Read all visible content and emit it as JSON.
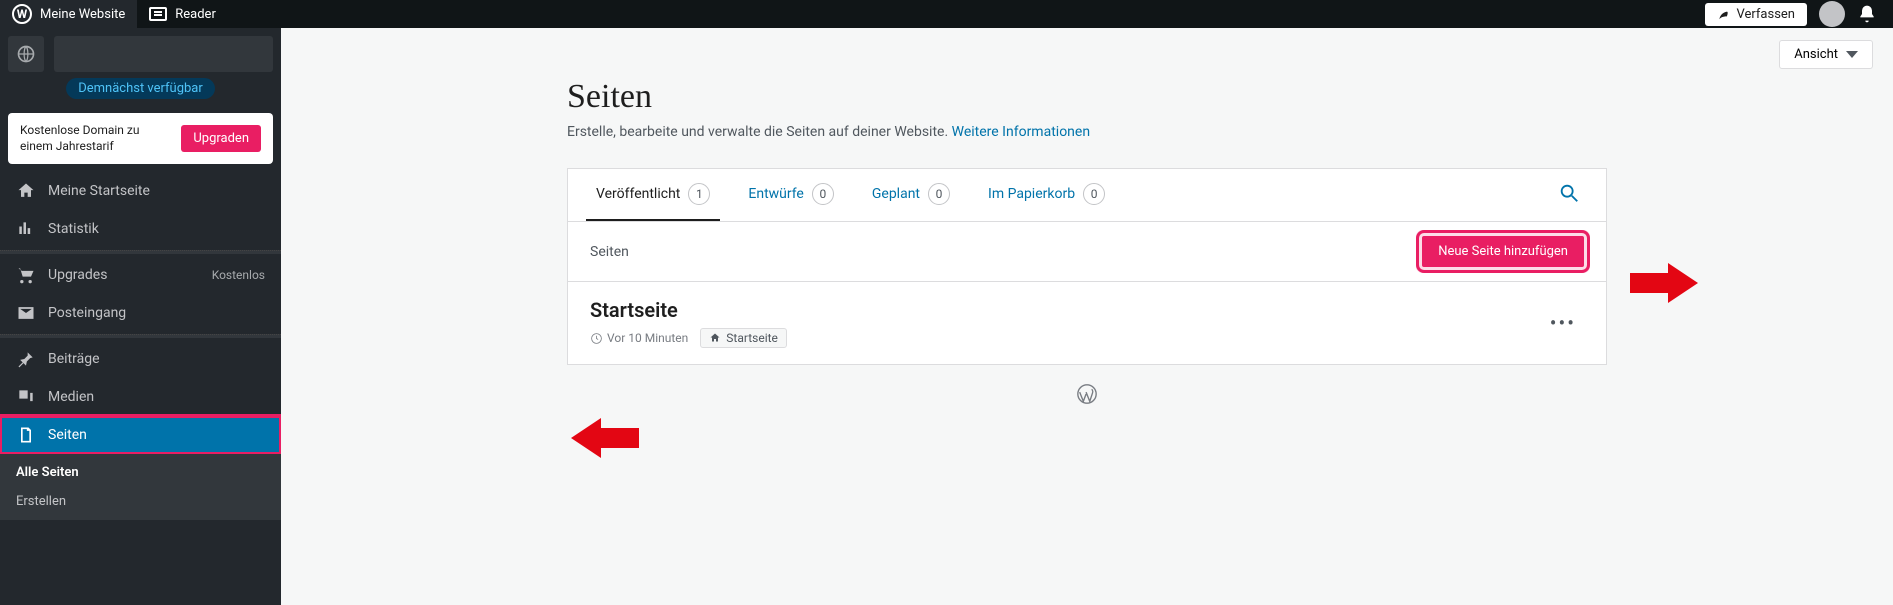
{
  "topbar": {
    "my_site": "Meine Website",
    "reader": "Reader",
    "compose": "Verfassen"
  },
  "sidebar": {
    "coming_soon": "Demnächst verfügbar",
    "domain_promo": "Kostenlose Domain zu einem Jahrestarif",
    "upgrade_btn": "Upgraden",
    "items": {
      "home": "Meine Startseite",
      "stats": "Statistik",
      "upgrades": "Upgrades",
      "upgrades_meta": "Kostenlos",
      "inbox": "Posteingang",
      "posts": "Beiträge",
      "media": "Medien",
      "pages": "Seiten"
    },
    "submenu": {
      "all_pages": "Alle Seiten",
      "create": "Erstellen"
    }
  },
  "main": {
    "view_toggle": "Ansicht",
    "title": "Seiten",
    "description": "Erstelle, bearbeite und verwalte die Seiten auf deiner Website. ",
    "more_info": "Weitere Informationen",
    "tabs": {
      "published": {
        "label": "Veröffentlicht",
        "count": "1"
      },
      "drafts": {
        "label": "Entwürfe",
        "count": "0"
      },
      "scheduled": {
        "label": "Geplant",
        "count": "0"
      },
      "trash": {
        "label": "Im Papierkorb",
        "count": "0"
      }
    },
    "section_label": "Seiten",
    "add_button": "Neue Seite hinzufügen",
    "page_item": {
      "title": "Startseite",
      "time": "Vor 10 Minuten",
      "home_badge": "Startseite"
    }
  }
}
